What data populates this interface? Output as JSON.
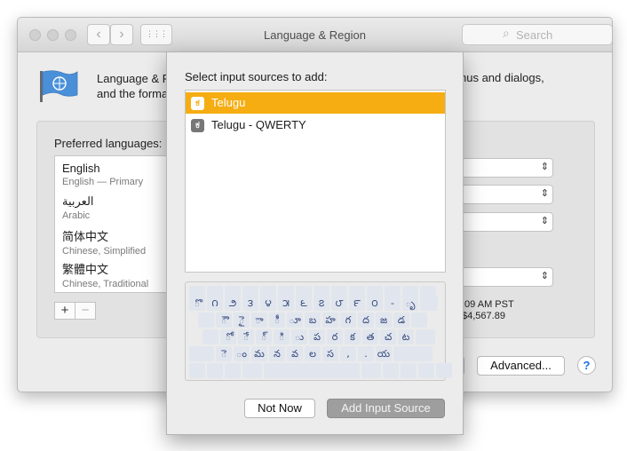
{
  "window": {
    "title": "Language & Region",
    "search_placeholder": "Search",
    "nav_back": "‹",
    "nav_forward": "›",
    "grid_icon": "⋮⋮⋮"
  },
  "header": {
    "desc_line1": "Language & R",
    "desc_line2": "and the forma",
    "desc_right": "nus and dialogs,"
  },
  "preferred": {
    "label": "Preferred languages:",
    "languages": [
      {
        "name": "English",
        "sub": "English — Primary"
      },
      {
        "name": "العربية",
        "sub": "Arabic"
      },
      {
        "name": "简体中文",
        "sub": "Chinese, Simplified"
      },
      {
        "name": "繁體中文",
        "sub": "Chinese, Traditional"
      }
    ],
    "add": "+",
    "remove": "−"
  },
  "formats": {
    "time": ":09 AM PST",
    "number": "$4,567.89"
  },
  "buttons": {
    "advanced": "Advanced...",
    "help": "?"
  },
  "sheet": {
    "title": "Select input sources to add:",
    "sources": [
      {
        "icon": "ಕ",
        "label": "Telugu",
        "selected": true
      },
      {
        "icon": "ಕ",
        "label": "Telugu - QWERTY",
        "selected": false
      }
    ],
    "keyboard": {
      "row1": [
        "ొ",
        "౧",
        "౨",
        "౩",
        "౪",
        "౫",
        "౬",
        "౭",
        "౮",
        "౯",
        "౦",
        "-",
        "ృ"
      ],
      "row2": [
        "ౌ",
        "ై",
        "ా",
        "ీ",
        "ూ",
        "బ",
        "హ",
        "గ",
        "ద",
        "జ",
        "డ"
      ],
      "row3": [
        "ో",
        "ే",
        "్",
        "ి",
        "ు",
        "ప",
        "ర",
        "క",
        "త",
        "చ",
        "ట"
      ],
      "row4": [
        "ె",
        "ం",
        "మ",
        "న",
        "వ",
        "ల",
        "స",
        ",",
        ".",
        "య"
      ]
    },
    "not_now": "Not Now",
    "add_source": "Add Input Source"
  },
  "colors": {
    "selection": "#f5ad12",
    "accent": "#1c6fe0"
  }
}
